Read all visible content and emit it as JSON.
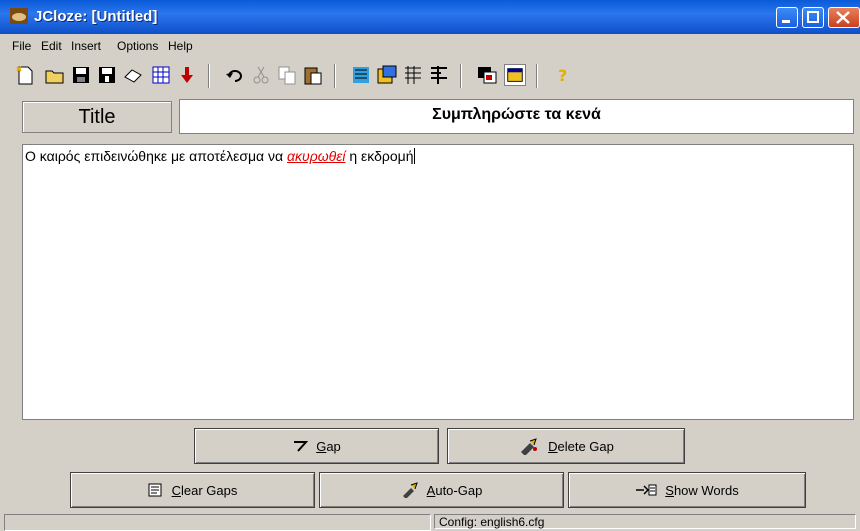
{
  "window": {
    "title": "JCloze: [Untitled]"
  },
  "menu": [
    "File",
    "Edit",
    "Insert",
    "Options",
    "Help"
  ],
  "toolbar_icons": [
    "new-icon",
    "open-icon",
    "save-icon",
    "save-as-icon",
    "eraser-icon",
    "web-icon",
    "download-icon",
    "undo-icon",
    "cut-icon",
    "copy-icon",
    "paste-icon",
    "gap-icon",
    "auto-gap-icon",
    "clear-gaps-icon",
    "show-words-icon",
    "config-icon",
    "settings-icon",
    "help-icon"
  ],
  "title_section": {
    "label": "Title",
    "value": "Συμπληρώστε τα κενά"
  },
  "editor": {
    "before": "Ο καιρός επιδεινώθηκε με αποτέλεσμα να ",
    "gap_word": "ακυρωθεί",
    "after": " η εκδρομή"
  },
  "buttons": {
    "gap": {
      "hotkey": "G",
      "rest": "ap"
    },
    "delete_gap": {
      "hotkey": "D",
      "rest": "elete Gap"
    },
    "clear_gaps": {
      "hotkey": "C",
      "rest": "lear Gaps"
    },
    "auto_gap": {
      "hotkey": "A",
      "rest": "uto-Gap"
    },
    "show_words": {
      "hotkey": "S",
      "rest": "how Words"
    }
  },
  "status": {
    "config": "Config: english6.cfg"
  },
  "colors": {
    "gap_word": "#e00000",
    "titlebar": "#0a5ad8"
  }
}
